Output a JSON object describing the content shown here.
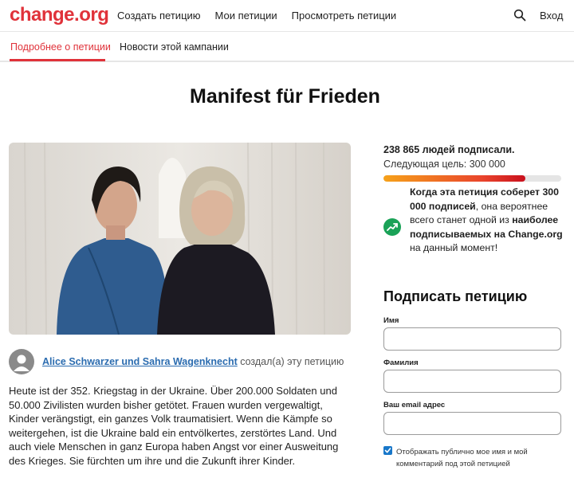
{
  "header": {
    "logo": "change.org",
    "nav": [
      "Создать петицию",
      "Мои петиции",
      "Просмотреть петиции"
    ],
    "search_icon": "search-icon",
    "login": "Вход"
  },
  "tabs": {
    "active": "Подробнее о петиции",
    "other": "Новости этой кампании"
  },
  "petition": {
    "title": "Manifest für Frieden",
    "author_names": "Alice Schwarzer und Sahra Wagenknecht",
    "author_suffix": "создал(а) эту петицию",
    "description": "Heute ist der 352. Kriegstag in der Ukraine. Über 200.000 Soldaten und 50.000 Zivilisten wurden bisher getötet. Frauen wurden vergewaltigt, Kinder verängstigt, ein ganzes Volk traumatisiert. Wenn die Kämpfe so weitergehen, ist die Ukraine bald ein entvölkertes, zerstörtes Land. Und auch viele Menschen in ganz Europa haben Angst vor einer Ausweitung des Krieges. Sie fürchten um ihre und die Zukunft ihrer Kinder."
  },
  "stats": {
    "signed": "238 865 людей подписали.",
    "goal": "Следующая цель: 300 000",
    "progress_fraction": 0.8,
    "promo_1": "Когда эта петиция соберет 300 000 подписей",
    "promo_2": ", она вероятнее всего станет одной из ",
    "promo_3": "наиболее подписываемых на Change.org",
    "promo_4": " на данный момент!"
  },
  "form": {
    "title": "Подписать петицию",
    "first_name_label": "Имя",
    "last_name_label": "Фамилия",
    "email_label": "Ваш email адрес",
    "consent_text": "Отображать публично мое имя и мой комментарий под этой петицией"
  },
  "colors": {
    "brand": "#e0323a",
    "link": "#2b6cb0",
    "trend": "#1aa257",
    "checkbox": "#1877c9"
  }
}
